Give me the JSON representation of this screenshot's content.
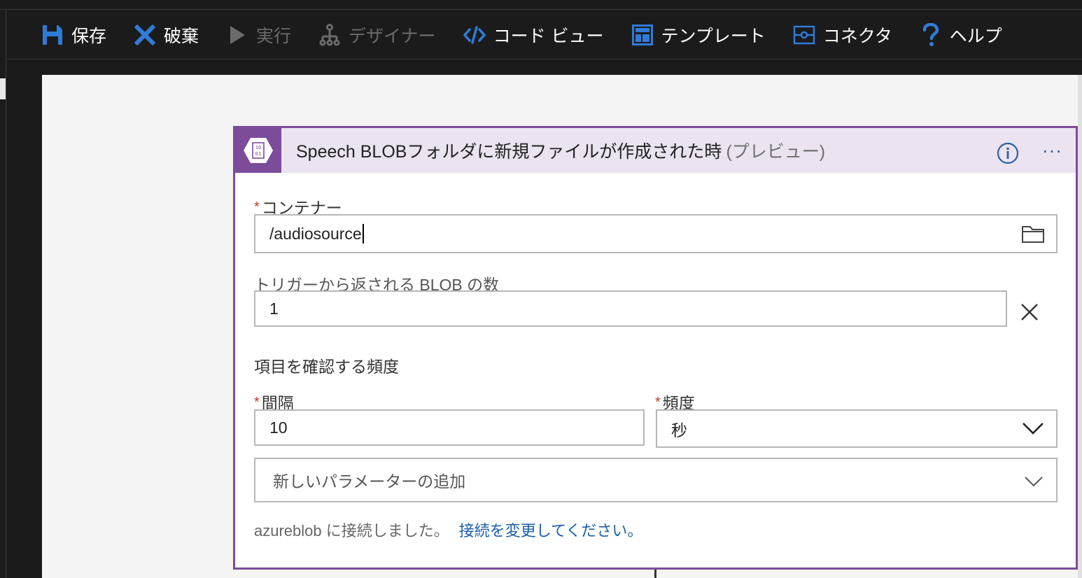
{
  "toolbar": {
    "items": [
      {
        "label": "保存",
        "icon": "save-icon",
        "enabled": true
      },
      {
        "label": "破棄",
        "icon": "discard-x-icon",
        "enabled": true
      },
      {
        "label": "実行",
        "icon": "run-play-icon",
        "enabled": false
      },
      {
        "label": "デザイナー",
        "icon": "designer-tree-icon",
        "enabled": false
      },
      {
        "label": "コード ビュー",
        "icon": "code-view-icon",
        "enabled": true
      },
      {
        "label": "テンプレート",
        "icon": "template-icon",
        "enabled": true
      },
      {
        "label": "コネクタ",
        "icon": "connector-icon",
        "enabled": true
      },
      {
        "label": "ヘルプ",
        "icon": "help-question-icon",
        "enabled": true
      }
    ]
  },
  "card": {
    "title": "Speech BLOBフォルダに新規ファイルが作成された時",
    "title_suffix": "(プレビュー)",
    "badge_icon": "blob-storage-icon",
    "info_icon": "info-icon",
    "more_icon": "ellipsis-icon",
    "more_label": "···"
  },
  "fields": {
    "container": {
      "label": "コンテナー",
      "required": true,
      "value": "/audiosource",
      "icon": "folder-icon"
    },
    "blob_count": {
      "label": "トリガーから返される BLOB の数",
      "required": false,
      "value": "1",
      "clear_icon": "clear-x-icon"
    },
    "section_heading": "項目を確認する頻度",
    "interval": {
      "label": "間隔",
      "required": true,
      "value": "10"
    },
    "frequency": {
      "label": "頻度",
      "required": true,
      "value": "秒",
      "icon": "chevron-down-icon"
    },
    "add_parameter": {
      "placeholder": "新しいパラメーターの追加",
      "icon": "chevron-down-icon"
    }
  },
  "footer": {
    "text": "azureblob に接続しました。",
    "link": "接続を変更してください。"
  },
  "colors": {
    "accent_purple": "#7c4c9a",
    "header_bg": "#ebe3ef",
    "toolbar_icon_blue": "#2f7bd8",
    "link_blue": "#1a5ea8",
    "required_red": "#c0392b"
  }
}
